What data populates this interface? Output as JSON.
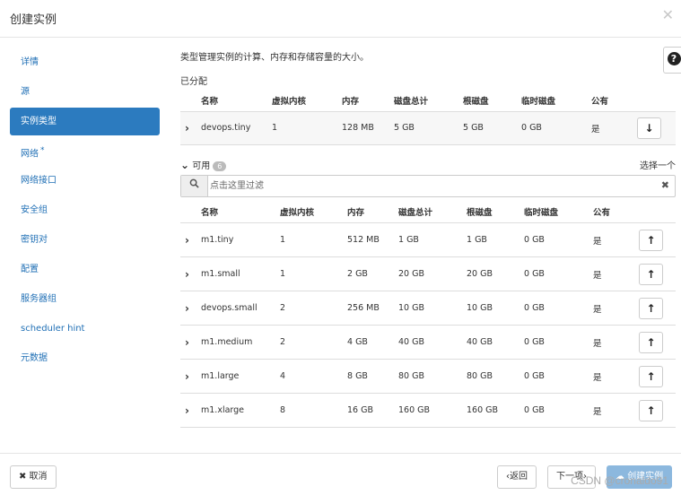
{
  "dialog": {
    "title": "创建实例"
  },
  "sidebar": {
    "items": [
      {
        "label": "详情"
      },
      {
        "label": "源"
      },
      {
        "label": "实例类型"
      },
      {
        "label": "网络",
        "required_mark": "*"
      },
      {
        "label": "网络接口"
      },
      {
        "label": "安全组"
      },
      {
        "label": "密钥对"
      },
      {
        "label": "配置"
      },
      {
        "label": "服务器组"
      },
      {
        "label": "scheduler hint"
      },
      {
        "label": "元数据"
      }
    ],
    "active_index": 2
  },
  "main": {
    "description": "类型管理实例的计算、内存和存储容量的大小。",
    "allocated_label": "已分配",
    "columns": [
      "名称",
      "虚拟内核",
      "内存",
      "磁盘总计",
      "根磁盘",
      "临时磁盘",
      "公有"
    ],
    "allocated": [
      {
        "name": "devops.tiny",
        "vcpus": "1",
        "ram": "128 MB",
        "disk_total": "5 GB",
        "root_disk": "5 GB",
        "ephemeral": "0 GB",
        "public": "是"
      }
    ],
    "available_label": "可用",
    "available_count": "6",
    "select_one": "选择一个",
    "filter_placeholder": "点击这里过滤",
    "available": [
      {
        "name": "m1.tiny",
        "vcpus": "1",
        "ram": "512 MB",
        "disk_total": "1 GB",
        "root_disk": "1 GB",
        "ephemeral": "0 GB",
        "public": "是"
      },
      {
        "name": "m1.small",
        "vcpus": "1",
        "ram": "2 GB",
        "disk_total": "20 GB",
        "root_disk": "20 GB",
        "ephemeral": "0 GB",
        "public": "是"
      },
      {
        "name": "devops.small",
        "vcpus": "2",
        "ram": "256 MB",
        "disk_total": "10 GB",
        "root_disk": "10 GB",
        "ephemeral": "0 GB",
        "public": "是"
      },
      {
        "name": "m1.medium",
        "vcpus": "2",
        "ram": "4 GB",
        "disk_total": "40 GB",
        "root_disk": "40 GB",
        "ephemeral": "0 GB",
        "public": "是"
      },
      {
        "name": "m1.large",
        "vcpus": "4",
        "ram": "8 GB",
        "disk_total": "80 GB",
        "root_disk": "80 GB",
        "ephemeral": "0 GB",
        "public": "是"
      },
      {
        "name": "m1.xlarge",
        "vcpus": "8",
        "ram": "16 GB",
        "disk_total": "160 GB",
        "root_disk": "160 GB",
        "ephemeral": "0 GB",
        "public": "是"
      }
    ]
  },
  "footer": {
    "cancel_label": "✖ 取消",
    "back_label": "‹返回",
    "next_label": "下一项›",
    "create_label": "创建实例"
  },
  "watermark": "CSDN @cronaldo91",
  "icons": {
    "close": "close-icon",
    "help": "help-icon",
    "search": "search-icon",
    "clear": "clear-icon",
    "expand": "chevron-right-icon",
    "collapse": "chevron-down-icon",
    "deallocate": "arrow-down-icon",
    "allocate": "arrow-up-icon",
    "create": "cloud-upload-icon"
  },
  "colors": {
    "accent": "#2c7bbf",
    "link": "#1f6fb5",
    "primary_disabled": "#8cb8de"
  }
}
